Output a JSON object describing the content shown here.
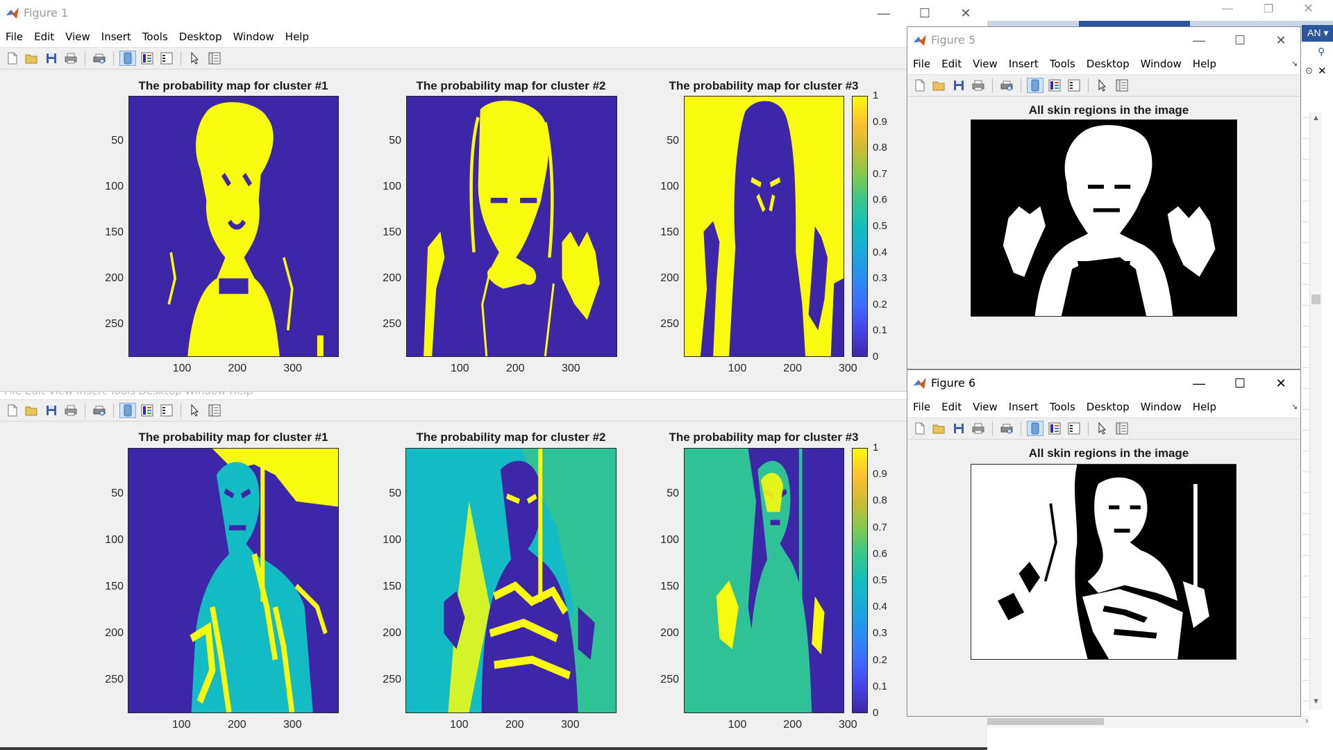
{
  "colors": {
    "viridis_low": "#3e26a8",
    "viridis_high": "#f9fb0e",
    "mid_cyan": "#13bcc4",
    "mid_teal": "#2fc296",
    "mid_blue": "#2b90e4"
  },
  "figure1": {
    "title": "Figure 1",
    "menu": [
      "File",
      "Edit",
      "View",
      "Insert",
      "Tools",
      "Desktop",
      "Window",
      "Help"
    ],
    "axes_titles": [
      "The probability map for cluster #1",
      "The probability map for cluster #2",
      "The probability map for cluster #3"
    ],
    "y_ticks": [
      "50",
      "100",
      "150",
      "200",
      "250"
    ],
    "x_ticks": [
      "100",
      "200",
      "300"
    ],
    "colorbar_ticks": [
      "1",
      "0.9",
      "0.8",
      "0.7",
      "0.6",
      "0.5",
      "0.4",
      "0.3",
      "0.2",
      "0.1",
      "0"
    ]
  },
  "figure_lower": {
    "axes_titles": [
      "The probability map for cluster #1",
      "The probability map for cluster #2",
      "The probability map for cluster #3"
    ],
    "y_ticks": [
      "50",
      "100",
      "150",
      "200",
      "250"
    ],
    "x_ticks": [
      "100",
      "200",
      "300"
    ],
    "colorbar_ticks": [
      "1",
      "0.9",
      "0.8",
      "0.7",
      "0.6",
      "0.5",
      "0.4",
      "0.3",
      "0.2",
      "0.1",
      "0"
    ]
  },
  "figure5": {
    "title": "Figure 5",
    "menu": [
      "File",
      "Edit",
      "View",
      "Insert",
      "Tools",
      "Desktop",
      "Window",
      "Help"
    ],
    "axes_title": "All skin regions in the image"
  },
  "figure6": {
    "title": "Figure 6",
    "menu": [
      "File",
      "Edit",
      "View",
      "Insert",
      "Tools",
      "Desktop",
      "Window",
      "Help"
    ],
    "axes_title": "All skin regions in the image"
  },
  "background_app": {
    "label": "AN"
  },
  "icons": {
    "window_controls": [
      "minimize-icon",
      "maximize-icon",
      "close-icon"
    ],
    "toolbar": [
      "new-figure-icon",
      "open-file-icon",
      "save-icon",
      "print-icon",
      "print-preview-icon",
      "link-icon",
      "insert-colorbar-icon",
      "insert-legend-icon",
      "edit-plot-icon",
      "property-inspector-icon"
    ]
  }
}
